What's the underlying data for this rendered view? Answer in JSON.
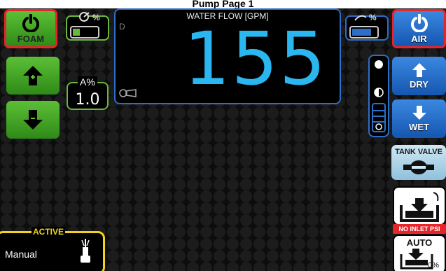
{
  "header": {
    "partial_title": "Pump Page 1"
  },
  "flow": {
    "title": "WATER FLOW [GPM]",
    "mode_letter": "D",
    "value": "155"
  },
  "left": {
    "foam_label": "FOAM",
    "a_label": "A%",
    "a_value": "1.0",
    "foam_bar_fill_pct": 30
  },
  "right": {
    "air_label": "AIR",
    "dry_label": "DRY",
    "wet_label": "WET",
    "tank_valve_label": "TANK VALVE",
    "no_inlet_label": "NO INLET PSI",
    "auto_label": "AUTO",
    "auto_pct": "0%",
    "air_bar_fill_pct": 80
  },
  "active": {
    "label": "ACTIVE",
    "mode": "Manual"
  },
  "colors": {
    "green": "#4aa82a",
    "blue": "#2368c8",
    "flow_value": "#2ab7f0",
    "active_border": "#f2d21b",
    "alert_red": "#e5252a"
  },
  "icons": [
    "power-icon",
    "arrow-up-icon",
    "arrow-down-icon",
    "nozzle-icon",
    "valve-icon",
    "tank-fill-icon"
  ]
}
